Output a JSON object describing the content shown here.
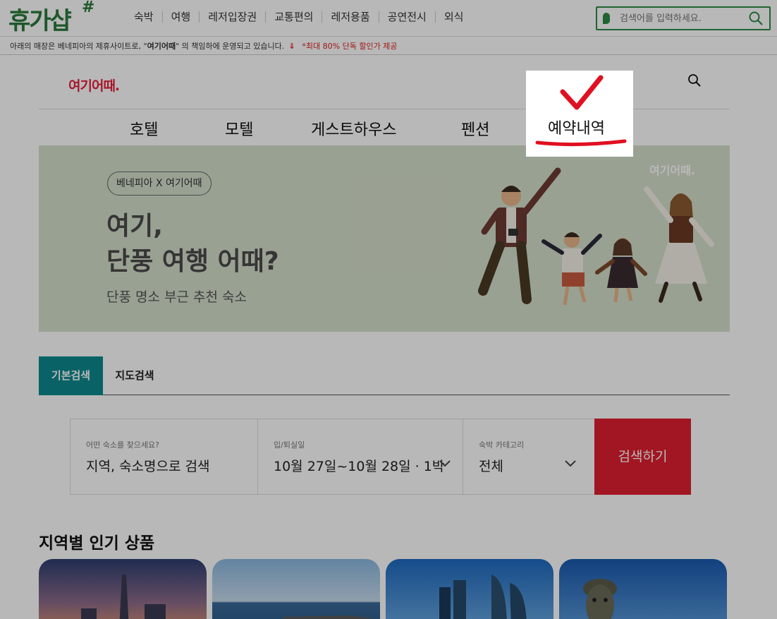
{
  "topbar": {
    "logo": "휴가샵",
    "menu": [
      "숙박",
      "여행",
      "레저입장권",
      "교통편의",
      "레저용품",
      "공연전시",
      "외식"
    ],
    "search_placeholder": "검색어를 입력하세요."
  },
  "notice": {
    "text_pre": "아래의 매장은 베네피아의 제휴사이트로, \"",
    "text_bold": "여기어때",
    "text_post": "\" 의 책임하에 운영되고 있습니다.",
    "promo": "*최대 80% 단독 할인가 제공"
  },
  "site": {
    "logo": "여기어때.",
    "categories": [
      "호텔",
      "모텔",
      "게스트하우스",
      "펜션",
      "예약내역"
    ]
  },
  "banner": {
    "pill": "베네피아 X 여기어때",
    "headline_1": "여기,",
    "headline_2": "단풍 여행 어때?",
    "subline": "단풍 명소 부근 추천 숙소",
    "logo": "여기어때."
  },
  "tabs": [
    "기본검색",
    "지도검색"
  ],
  "search_form": {
    "place_label": "어떤 숙소를 찾으세요?",
    "place_value": "지역, 숙소명으로 검색",
    "date_label": "입/퇴실일",
    "date_value": "10월 27일~10월 28일 · 1박",
    "category_label": "숙박 카테고리",
    "category_value": "전체",
    "submit": "검색하기"
  },
  "region_title": "지역별 인기 상품",
  "colors": {
    "accent_green": "#2c8a45",
    "tab_teal": "#0d8a8e",
    "submit_red": "#e01f30",
    "mark_red": "#e01020"
  }
}
